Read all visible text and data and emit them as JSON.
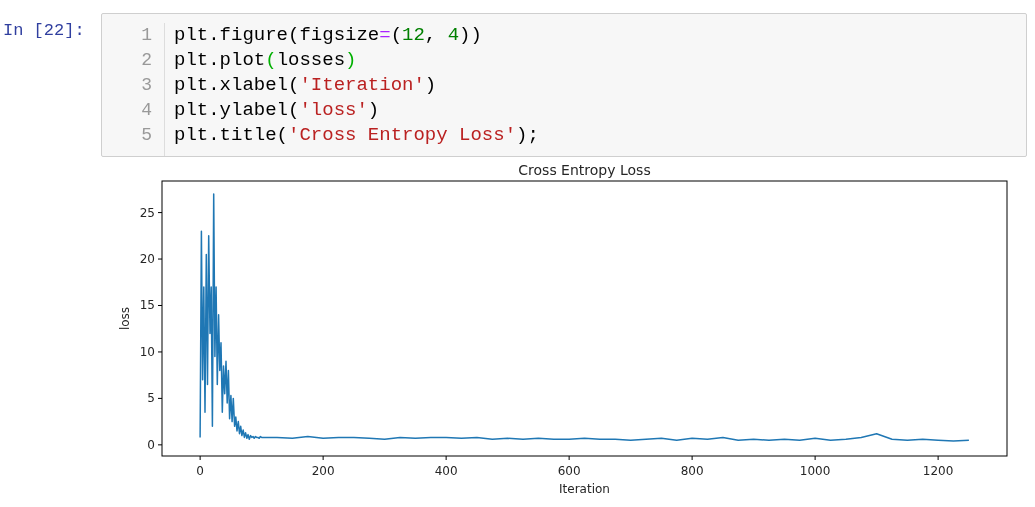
{
  "cell": {
    "prompt": "In [22]:",
    "lines": [
      {
        "number": "1",
        "tokens": [
          {
            "kind": "plain",
            "text": "plt.figure(figsize"
          },
          {
            "kind": "operator",
            "text": "="
          },
          {
            "kind": "plain",
            "text": "("
          },
          {
            "kind": "number",
            "text": "12"
          },
          {
            "kind": "plain",
            "text": ", "
          },
          {
            "kind": "number",
            "text": "4"
          },
          {
            "kind": "plain",
            "text": "))"
          }
        ]
      },
      {
        "number": "2",
        "tokens": [
          {
            "kind": "plain",
            "text": "plt.plot"
          },
          {
            "kind": "bracket",
            "text": "("
          },
          {
            "kind": "plain",
            "text": "losses"
          },
          {
            "kind": "bracket",
            "text": ")"
          }
        ]
      },
      {
        "number": "3",
        "tokens": [
          {
            "kind": "plain",
            "text": "plt.xlabel("
          },
          {
            "kind": "string",
            "text": "'Iteration'"
          },
          {
            "kind": "plain",
            "text": ")"
          }
        ]
      },
      {
        "number": "4",
        "tokens": [
          {
            "kind": "plain",
            "text": "plt.ylabel("
          },
          {
            "kind": "string",
            "text": "'loss'"
          },
          {
            "kind": "plain",
            "text": ")"
          }
        ]
      },
      {
        "number": "5",
        "tokens": [
          {
            "kind": "plain",
            "text": "plt.title("
          },
          {
            "kind": "string",
            "text": "'Cross Entropy Loss'"
          },
          {
            "kind": "plain",
            "text": ");"
          }
        ]
      }
    ]
  },
  "output": {
    "chart_data": {
      "type": "line",
      "title": "Cross Entropy Loss",
      "xlabel": "Iteration",
      "ylabel": "loss",
      "xlim": [
        -62,
        1312
      ],
      "ylim": [
        -1.2,
        28.4
      ],
      "xticks": [
        0,
        200,
        400,
        600,
        800,
        1000,
        1200
      ],
      "yticks": [
        0,
        5,
        10,
        15,
        20,
        25
      ],
      "x": [
        0,
        2,
        4,
        6,
        8,
        10,
        12,
        14,
        16,
        18,
        20,
        22,
        24,
        26,
        28,
        30,
        32,
        34,
        36,
        38,
        40,
        42,
        44,
        46,
        48,
        50,
        52,
        54,
        56,
        58,
        60,
        62,
        64,
        66,
        68,
        70,
        72,
        74,
        76,
        78,
        80,
        82,
        84,
        86,
        88,
        90,
        92,
        94,
        96,
        98,
        100,
        125,
        150,
        175,
        200,
        225,
        250,
        275,
        300,
        325,
        350,
        375,
        400,
        425,
        450,
        475,
        500,
        525,
        550,
        575,
        600,
        625,
        650,
        675,
        700,
        725,
        750,
        775,
        800,
        825,
        850,
        875,
        900,
        925,
        950,
        975,
        1000,
        1025,
        1050,
        1075,
        1100,
        1125,
        1150,
        1175,
        1200,
        1225,
        1250
      ],
      "series": [
        {
          "color": "#1f77b4",
          "values": [
            0.8,
            23,
            7,
            17,
            3.5,
            20.5,
            6.5,
            22.5,
            12,
            17,
            2,
            27,
            9.5,
            17,
            6.5,
            14,
            8,
            11,
            3.5,
            8.5,
            5.5,
            9,
            4.5,
            8,
            2.8,
            5.3,
            2.5,
            5,
            2,
            3,
            1.5,
            2.5,
            1.2,
            2,
            1,
            1.6,
            0.8,
            1.3,
            0.7,
            1.1,
            0.6,
            1,
            0.8,
            0.9,
            0.7,
            0.9,
            0.8,
            0.8,
            0.7,
            0.9,
            0.8,
            0.8,
            0.7,
            0.9,
            0.7,
            0.8,
            0.8,
            0.7,
            0.6,
            0.8,
            0.7,
            0.8,
            0.8,
            0.7,
            0.8,
            0.6,
            0.7,
            0.6,
            0.7,
            0.6,
            0.6,
            0.7,
            0.6,
            0.6,
            0.5,
            0.6,
            0.7,
            0.5,
            0.7,
            0.6,
            0.8,
            0.5,
            0.6,
            0.5,
            0.6,
            0.5,
            0.7,
            0.5,
            0.6,
            0.8,
            1.2,
            0.6,
            0.5,
            0.6,
            0.5,
            0.4,
            0.5
          ]
        }
      ]
    }
  }
}
